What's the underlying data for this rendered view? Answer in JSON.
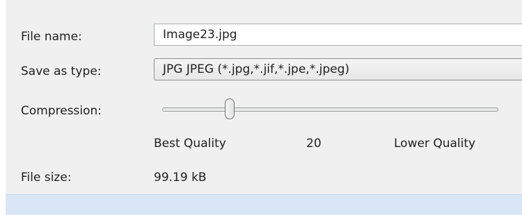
{
  "file_name": {
    "label": "File name:",
    "value": "Image23.jpg"
  },
  "save_as_type": {
    "label": "Save as type:",
    "selected": "JPG JPEG  (*.jpg,*.jif,*.jpe,*.jpeg)"
  },
  "compression": {
    "label": "Compression:",
    "value": 20,
    "min_label": "Best Quality",
    "max_label": "Lower Quality",
    "value_label": "20"
  },
  "file_size": {
    "label": "File size:",
    "value": "99.19 kB"
  },
  "colors": {
    "panel_background": "#f0f0f0",
    "footer_bar": "#d8e6f6"
  }
}
